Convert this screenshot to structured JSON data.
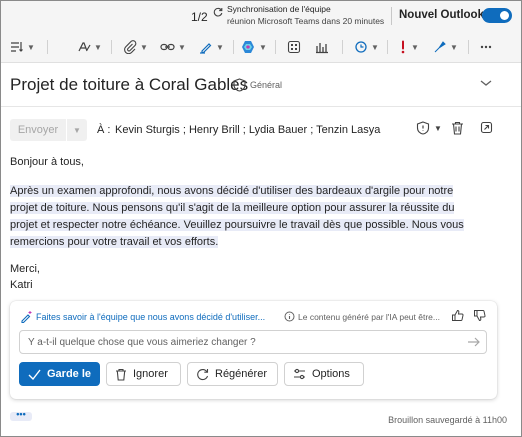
{
  "notification": {
    "counter": "1/2",
    "title": "Synchronisation de l'équipe",
    "subtitle": "réunion Microsoft Teams dans 20 minutes"
  },
  "new_outlook": {
    "label": "Nouvel Outlook",
    "enabled": true
  },
  "toolbar": {
    "icons": [
      "paragraph-format-icon",
      "format-painter-icon",
      "attach-icon",
      "link-icon",
      "signature-pen-icon",
      "copilot-icon",
      "apps-icon",
      "insights-chart-icon",
      "loop-icon",
      "importance-icon",
      "sensitivity-icon",
      "more-icon"
    ]
  },
  "message": {
    "subject": "Projet de toiture à Coral Gables",
    "sensitivity": "Général",
    "send_label": "Envoyer",
    "to_label": "À :",
    "recipients": "Kevin Sturgis ; Henry Brill ; Lydia Bauer ; Tenzin Lasya",
    "greeting": "Bonjour à tous,",
    "paragraph": "Après un examen approfondi, nous avons décidé d'utiliser des bardeaux d'argile pour notre projet de toiture. Nous pensons qu'il s'agit de la meilleure option pour assurer la réussite du projet et respecter notre échéance. Veuillez poursuivre le travail dès que possible. Nous vous remercions pour votre travail et vos efforts.",
    "signoff": "Merci,",
    "signature": "Katri"
  },
  "copilot": {
    "prompt": "Faites savoir à l'équipe que nous avons décidé d'utiliser...",
    "disclaimer": "Le contenu généré par l'IA peut être...",
    "input_placeholder": "Y a-t-il quelque chose que vous aimeriez changer ?",
    "keep_label": "Garde le",
    "discard_label": "Ignorer",
    "regenerate_label": "Régénérer",
    "options_label": "Options"
  },
  "footer": {
    "more_label": "•••",
    "draft_status": "Brouillon sauvegardé à 11h00"
  },
  "colors": {
    "accent": "#0f6cbd",
    "highlight": "#e8ebf7",
    "importance": "#c50f1f",
    "sensitivity": "#0f6cbd"
  }
}
